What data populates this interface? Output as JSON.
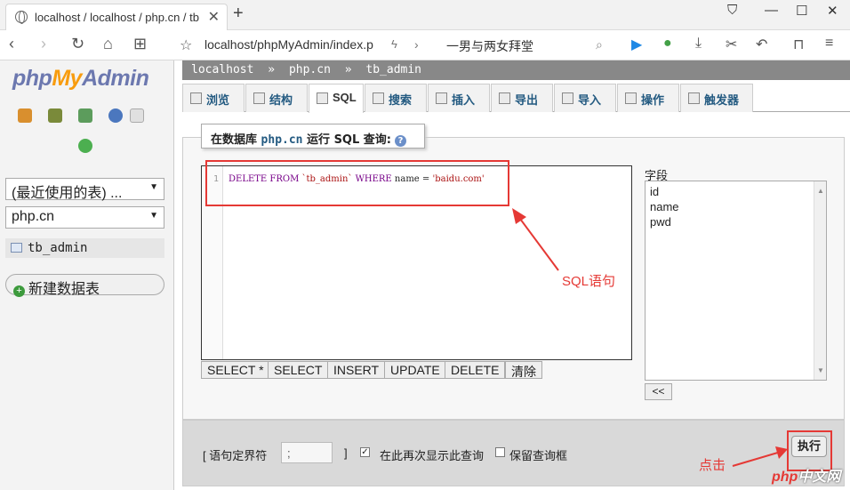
{
  "browser": {
    "tab_title": "localhost / localhost / php.cn / tb",
    "address": "localhost/phpMyAdmin/index.p",
    "search_text": "一男与两女拜堂"
  },
  "sidebar": {
    "logo_php": "php",
    "logo_my": "My",
    "logo_admin": "Admin",
    "recent_select": "(最近使用的表) ...",
    "db_select": "php.cn",
    "table_item": "tb_admin",
    "new_table": "新建数据表"
  },
  "breadcrumb": {
    "server": "localhost",
    "database": "php.cn",
    "table": "tb_admin"
  },
  "tabs": [
    {
      "label": "浏览"
    },
    {
      "label": "结构"
    },
    {
      "label": "SQL"
    },
    {
      "label": "搜索"
    },
    {
      "label": "插入"
    },
    {
      "label": "导出"
    },
    {
      "label": "导入"
    },
    {
      "label": "操作"
    },
    {
      "label": "触发器"
    }
  ],
  "query": {
    "legend_prefix": "在数据库",
    "legend_db": "php.cn",
    "legend_suffix": "运行 SQL 查询:",
    "line_number": "1",
    "code_kw1": "DELETE FROM",
    "code_table": "`tb_admin`",
    "code_kw2": "WHERE",
    "code_rest": "name =",
    "code_value": "'baidu.com'",
    "buttons": [
      "SELECT *",
      "SELECT",
      "INSERT",
      "UPDATE",
      "DELETE",
      "清除"
    ],
    "fields_label": "字段",
    "fields": [
      "id",
      "name",
      "pwd"
    ],
    "insert_button": "<<"
  },
  "footer": {
    "delimiter_label": "[ 语句定界符",
    "delimiter_value": ";",
    "delimiter_close": "]",
    "show_again_label": "在此再次显示此查询",
    "show_again_checked": true,
    "retain_label": "保留查询框",
    "retain_checked": false,
    "go_button": "执行"
  },
  "annotations": {
    "sql_label": "SQL语句",
    "click_label": "点击",
    "color": "#e53935"
  },
  "watermark": {
    "php": "php",
    "cn": "中文网"
  }
}
